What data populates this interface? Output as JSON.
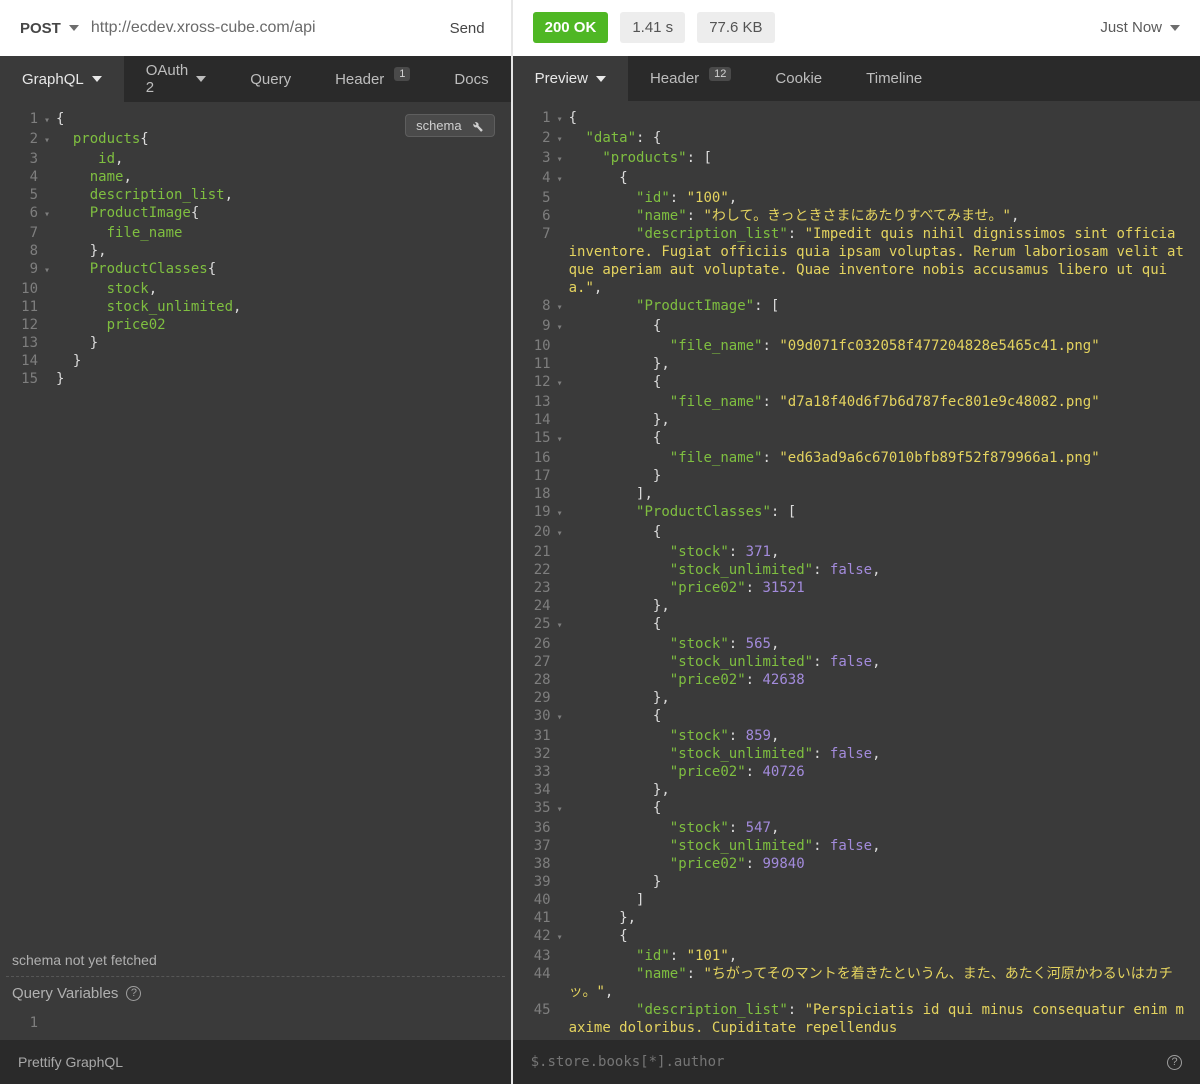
{
  "request": {
    "method": "POST",
    "url": "http://ecdev.xross-cube.com/api",
    "send_label": "Send"
  },
  "request_tabs": {
    "graphql": "GraphQL",
    "oauth2": "OAuth 2",
    "query": "Query",
    "header": "Header",
    "header_badge": "1",
    "docs": "Docs"
  },
  "schema_chip": "schema",
  "graphql_query_lines": [
    {
      "n": 1,
      "fold": "▾",
      "tokens": [
        {
          "t": "{",
          "c": "pl"
        }
      ]
    },
    {
      "n": 2,
      "fold": "▾",
      "tokens": [
        {
          "t": "  ",
          "c": "pl"
        },
        {
          "t": "products",
          "c": "kw"
        },
        {
          "t": "{",
          "c": "pl"
        }
      ]
    },
    {
      "n": 3,
      "fold": "",
      "tokens": [
        {
          "t": "     ",
          "c": "pl"
        },
        {
          "t": "id",
          "c": "kw"
        },
        {
          "t": ",",
          "c": "pl"
        }
      ]
    },
    {
      "n": 4,
      "fold": "",
      "tokens": [
        {
          "t": "    ",
          "c": "pl"
        },
        {
          "t": "name",
          "c": "kw"
        },
        {
          "t": ",",
          "c": "pl"
        }
      ]
    },
    {
      "n": 5,
      "fold": "",
      "tokens": [
        {
          "t": "    ",
          "c": "pl"
        },
        {
          "t": "description_list",
          "c": "kw"
        },
        {
          "t": ",",
          "c": "pl"
        }
      ]
    },
    {
      "n": 6,
      "fold": "▾",
      "tokens": [
        {
          "t": "    ",
          "c": "pl"
        },
        {
          "t": "ProductImage",
          "c": "kw"
        },
        {
          "t": "{",
          "c": "pl"
        }
      ]
    },
    {
      "n": 7,
      "fold": "",
      "tokens": [
        {
          "t": "      ",
          "c": "pl"
        },
        {
          "t": "file_name",
          "c": "kw"
        }
      ]
    },
    {
      "n": 8,
      "fold": "",
      "tokens": [
        {
          "t": "    ",
          "c": "pl"
        },
        {
          "t": "},",
          "c": "pl"
        }
      ]
    },
    {
      "n": 9,
      "fold": "▾",
      "tokens": [
        {
          "t": "    ",
          "c": "pl"
        },
        {
          "t": "ProductClasses",
          "c": "kw"
        },
        {
          "t": "{",
          "c": "pl"
        }
      ]
    },
    {
      "n": 10,
      "fold": "",
      "tokens": [
        {
          "t": "      ",
          "c": "pl"
        },
        {
          "t": "stock",
          "c": "kw"
        },
        {
          "t": ",",
          "c": "pl"
        }
      ]
    },
    {
      "n": 11,
      "fold": "",
      "tokens": [
        {
          "t": "      ",
          "c": "pl"
        },
        {
          "t": "stock_unlimited",
          "c": "kw"
        },
        {
          "t": ",",
          "c": "pl"
        }
      ]
    },
    {
      "n": 12,
      "fold": "",
      "tokens": [
        {
          "t": "      ",
          "c": "pl"
        },
        {
          "t": "price02",
          "c": "kw"
        }
      ]
    },
    {
      "n": 13,
      "fold": "",
      "tokens": [
        {
          "t": "    ",
          "c": "pl"
        },
        {
          "t": "}",
          "c": "pl"
        }
      ]
    },
    {
      "n": 14,
      "fold": "",
      "tokens": [
        {
          "t": "  ",
          "c": "pl"
        },
        {
          "t": "}",
          "c": "pl"
        }
      ]
    },
    {
      "n": 15,
      "fold": "",
      "tokens": [
        {
          "t": "}",
          "c": "pl"
        }
      ]
    }
  ],
  "schema_status": "schema not yet fetched",
  "query_vars_label": "Query Variables",
  "query_vars_lines": [
    {
      "n": 1,
      "fold": "",
      "tokens": [
        {
          "t": " ",
          "c": "pl"
        }
      ]
    }
  ],
  "prettify_label": "Prettify GraphQL",
  "response": {
    "status": "200 OK",
    "time": "1.41 s",
    "size": "77.6 KB",
    "when": "Just Now"
  },
  "response_tabs": {
    "preview": "Preview",
    "header": "Header",
    "header_badge": "12",
    "cookie": "Cookie",
    "timeline": "Timeline"
  },
  "response_lines": [
    {
      "n": 1,
      "fold": "▾",
      "tokens": [
        {
          "t": "{",
          "c": "punc"
        }
      ]
    },
    {
      "n": 2,
      "fold": "▾",
      "tokens": [
        {
          "t": "  ",
          "c": "punc"
        },
        {
          "t": "\"data\"",
          "c": "key"
        },
        {
          "t": ": {",
          "c": "punc"
        }
      ]
    },
    {
      "n": 3,
      "fold": "▾",
      "tokens": [
        {
          "t": "    ",
          "c": "punc"
        },
        {
          "t": "\"products\"",
          "c": "key"
        },
        {
          "t": ": [",
          "c": "punc"
        }
      ]
    },
    {
      "n": 4,
      "fold": "▾",
      "tokens": [
        {
          "t": "      {",
          "c": "punc"
        }
      ]
    },
    {
      "n": 5,
      "fold": "",
      "tokens": [
        {
          "t": "        ",
          "c": "punc"
        },
        {
          "t": "\"id\"",
          "c": "key"
        },
        {
          "t": ": ",
          "c": "punc"
        },
        {
          "t": "\"100\"",
          "c": "str"
        },
        {
          "t": ",",
          "c": "punc"
        }
      ]
    },
    {
      "n": 6,
      "fold": "",
      "tokens": [
        {
          "t": "        ",
          "c": "punc"
        },
        {
          "t": "\"name\"",
          "c": "key"
        },
        {
          "t": ": ",
          "c": "punc"
        },
        {
          "t": "\"わして。きっときさまにあたりすべてみませ。\"",
          "c": "str"
        },
        {
          "t": ",",
          "c": "punc"
        }
      ]
    },
    {
      "n": 7,
      "fold": "",
      "tokens": [
        {
          "t": "        ",
          "c": "punc"
        },
        {
          "t": "\"description_list\"",
          "c": "key"
        },
        {
          "t": ": ",
          "c": "punc"
        },
        {
          "t": "\"Impedit quis nihil dignissimos sint officia inventore. Fugiat officiis quia ipsam voluptas. Rerum laboriosam velit atque aperiam aut voluptate. Quae inventore nobis accusamus libero ut quia.\"",
          "c": "str"
        },
        {
          "t": ",",
          "c": "punc"
        }
      ]
    },
    {
      "n": 8,
      "fold": "▾",
      "tokens": [
        {
          "t": "        ",
          "c": "punc"
        },
        {
          "t": "\"ProductImage\"",
          "c": "key"
        },
        {
          "t": ": [",
          "c": "punc"
        }
      ]
    },
    {
      "n": 9,
      "fold": "▾",
      "tokens": [
        {
          "t": "          {",
          "c": "punc"
        }
      ]
    },
    {
      "n": 10,
      "fold": "",
      "tokens": [
        {
          "t": "            ",
          "c": "punc"
        },
        {
          "t": "\"file_name\"",
          "c": "key"
        },
        {
          "t": ": ",
          "c": "punc"
        },
        {
          "t": "\"09d071fc032058f477204828e5465c41.png\"",
          "c": "str"
        }
      ]
    },
    {
      "n": 11,
      "fold": "",
      "tokens": [
        {
          "t": "          },",
          "c": "punc"
        }
      ]
    },
    {
      "n": 12,
      "fold": "▾",
      "tokens": [
        {
          "t": "          {",
          "c": "punc"
        }
      ]
    },
    {
      "n": 13,
      "fold": "",
      "tokens": [
        {
          "t": "            ",
          "c": "punc"
        },
        {
          "t": "\"file_name\"",
          "c": "key"
        },
        {
          "t": ": ",
          "c": "punc"
        },
        {
          "t": "\"d7a18f40d6f7b6d787fec801e9c48082.png\"",
          "c": "str"
        }
      ]
    },
    {
      "n": 14,
      "fold": "",
      "tokens": [
        {
          "t": "          },",
          "c": "punc"
        }
      ]
    },
    {
      "n": 15,
      "fold": "▾",
      "tokens": [
        {
          "t": "          {",
          "c": "punc"
        }
      ]
    },
    {
      "n": 16,
      "fold": "",
      "tokens": [
        {
          "t": "            ",
          "c": "punc"
        },
        {
          "t": "\"file_name\"",
          "c": "key"
        },
        {
          "t": ": ",
          "c": "punc"
        },
        {
          "t": "\"ed63ad9a6c67010bfb89f52f879966a1.png\"",
          "c": "str"
        }
      ]
    },
    {
      "n": 17,
      "fold": "",
      "tokens": [
        {
          "t": "          }",
          "c": "punc"
        }
      ]
    },
    {
      "n": 18,
      "fold": "",
      "tokens": [
        {
          "t": "        ],",
          "c": "punc"
        }
      ]
    },
    {
      "n": 19,
      "fold": "▾",
      "tokens": [
        {
          "t": "        ",
          "c": "punc"
        },
        {
          "t": "\"ProductClasses\"",
          "c": "key"
        },
        {
          "t": ": [",
          "c": "punc"
        }
      ]
    },
    {
      "n": 20,
      "fold": "▾",
      "tokens": [
        {
          "t": "          {",
          "c": "punc"
        }
      ]
    },
    {
      "n": 21,
      "fold": "",
      "tokens": [
        {
          "t": "            ",
          "c": "punc"
        },
        {
          "t": "\"stock\"",
          "c": "key"
        },
        {
          "t": ": ",
          "c": "punc"
        },
        {
          "t": "371",
          "c": "num"
        },
        {
          "t": ",",
          "c": "punc"
        }
      ]
    },
    {
      "n": 22,
      "fold": "",
      "tokens": [
        {
          "t": "            ",
          "c": "punc"
        },
        {
          "t": "\"stock_unlimited\"",
          "c": "key"
        },
        {
          "t": ": ",
          "c": "punc"
        },
        {
          "t": "false",
          "c": "bool"
        },
        {
          "t": ",",
          "c": "punc"
        }
      ]
    },
    {
      "n": 23,
      "fold": "",
      "tokens": [
        {
          "t": "            ",
          "c": "punc"
        },
        {
          "t": "\"price02\"",
          "c": "key"
        },
        {
          "t": ": ",
          "c": "punc"
        },
        {
          "t": "31521",
          "c": "num"
        }
      ]
    },
    {
      "n": 24,
      "fold": "",
      "tokens": [
        {
          "t": "          },",
          "c": "punc"
        }
      ]
    },
    {
      "n": 25,
      "fold": "▾",
      "tokens": [
        {
          "t": "          {",
          "c": "punc"
        }
      ]
    },
    {
      "n": 26,
      "fold": "",
      "tokens": [
        {
          "t": "            ",
          "c": "punc"
        },
        {
          "t": "\"stock\"",
          "c": "key"
        },
        {
          "t": ": ",
          "c": "punc"
        },
        {
          "t": "565",
          "c": "num"
        },
        {
          "t": ",",
          "c": "punc"
        }
      ]
    },
    {
      "n": 27,
      "fold": "",
      "tokens": [
        {
          "t": "            ",
          "c": "punc"
        },
        {
          "t": "\"stock_unlimited\"",
          "c": "key"
        },
        {
          "t": ": ",
          "c": "punc"
        },
        {
          "t": "false",
          "c": "bool"
        },
        {
          "t": ",",
          "c": "punc"
        }
      ]
    },
    {
      "n": 28,
      "fold": "",
      "tokens": [
        {
          "t": "            ",
          "c": "punc"
        },
        {
          "t": "\"price02\"",
          "c": "key"
        },
        {
          "t": ": ",
          "c": "punc"
        },
        {
          "t": "42638",
          "c": "num"
        }
      ]
    },
    {
      "n": 29,
      "fold": "",
      "tokens": [
        {
          "t": "          },",
          "c": "punc"
        }
      ]
    },
    {
      "n": 30,
      "fold": "▾",
      "tokens": [
        {
          "t": "          {",
          "c": "punc"
        }
      ]
    },
    {
      "n": 31,
      "fold": "",
      "tokens": [
        {
          "t": "            ",
          "c": "punc"
        },
        {
          "t": "\"stock\"",
          "c": "key"
        },
        {
          "t": ": ",
          "c": "punc"
        },
        {
          "t": "859",
          "c": "num"
        },
        {
          "t": ",",
          "c": "punc"
        }
      ]
    },
    {
      "n": 32,
      "fold": "",
      "tokens": [
        {
          "t": "            ",
          "c": "punc"
        },
        {
          "t": "\"stock_unlimited\"",
          "c": "key"
        },
        {
          "t": ": ",
          "c": "punc"
        },
        {
          "t": "false",
          "c": "bool"
        },
        {
          "t": ",",
          "c": "punc"
        }
      ]
    },
    {
      "n": 33,
      "fold": "",
      "tokens": [
        {
          "t": "            ",
          "c": "punc"
        },
        {
          "t": "\"price02\"",
          "c": "key"
        },
        {
          "t": ": ",
          "c": "punc"
        },
        {
          "t": "40726",
          "c": "num"
        }
      ]
    },
    {
      "n": 34,
      "fold": "",
      "tokens": [
        {
          "t": "          },",
          "c": "punc"
        }
      ]
    },
    {
      "n": 35,
      "fold": "▾",
      "tokens": [
        {
          "t": "          {",
          "c": "punc"
        }
      ]
    },
    {
      "n": 36,
      "fold": "",
      "tokens": [
        {
          "t": "            ",
          "c": "punc"
        },
        {
          "t": "\"stock\"",
          "c": "key"
        },
        {
          "t": ": ",
          "c": "punc"
        },
        {
          "t": "547",
          "c": "num"
        },
        {
          "t": ",",
          "c": "punc"
        }
      ]
    },
    {
      "n": 37,
      "fold": "",
      "tokens": [
        {
          "t": "            ",
          "c": "punc"
        },
        {
          "t": "\"stock_unlimited\"",
          "c": "key"
        },
        {
          "t": ": ",
          "c": "punc"
        },
        {
          "t": "false",
          "c": "bool"
        },
        {
          "t": ",",
          "c": "punc"
        }
      ]
    },
    {
      "n": 38,
      "fold": "",
      "tokens": [
        {
          "t": "            ",
          "c": "punc"
        },
        {
          "t": "\"price02\"",
          "c": "key"
        },
        {
          "t": ": ",
          "c": "punc"
        },
        {
          "t": "99840",
          "c": "num"
        }
      ]
    },
    {
      "n": 39,
      "fold": "",
      "tokens": [
        {
          "t": "          }",
          "c": "punc"
        }
      ]
    },
    {
      "n": 40,
      "fold": "",
      "tokens": [
        {
          "t": "        ]",
          "c": "punc"
        }
      ]
    },
    {
      "n": 41,
      "fold": "",
      "tokens": [
        {
          "t": "      },",
          "c": "punc"
        }
      ]
    },
    {
      "n": 42,
      "fold": "▾",
      "tokens": [
        {
          "t": "      {",
          "c": "punc"
        }
      ]
    },
    {
      "n": 43,
      "fold": "",
      "tokens": [
        {
          "t": "        ",
          "c": "punc"
        },
        {
          "t": "\"id\"",
          "c": "key"
        },
        {
          "t": ": ",
          "c": "punc"
        },
        {
          "t": "\"101\"",
          "c": "str"
        },
        {
          "t": ",",
          "c": "punc"
        }
      ]
    },
    {
      "n": 44,
      "fold": "",
      "tokens": [
        {
          "t": "        ",
          "c": "punc"
        },
        {
          "t": "\"name\"",
          "c": "key"
        },
        {
          "t": ": ",
          "c": "punc"
        },
        {
          "t": "\"ちがってそのマントを着きたというん、また、あたく河原かわるいはカチッ。\"",
          "c": "str"
        },
        {
          "t": ",",
          "c": "punc"
        }
      ]
    },
    {
      "n": 45,
      "fold": "",
      "tokens": [
        {
          "t": "        ",
          "c": "punc"
        },
        {
          "t": "\"description_list\"",
          "c": "key"
        },
        {
          "t": ": ",
          "c": "punc"
        },
        {
          "t": "\"Perspiciatis id qui minus consequatur enim maxime doloribus. Cupiditate repellendus",
          "c": "str"
        }
      ]
    }
  ],
  "filter_placeholder": "$.store.books[*].author"
}
